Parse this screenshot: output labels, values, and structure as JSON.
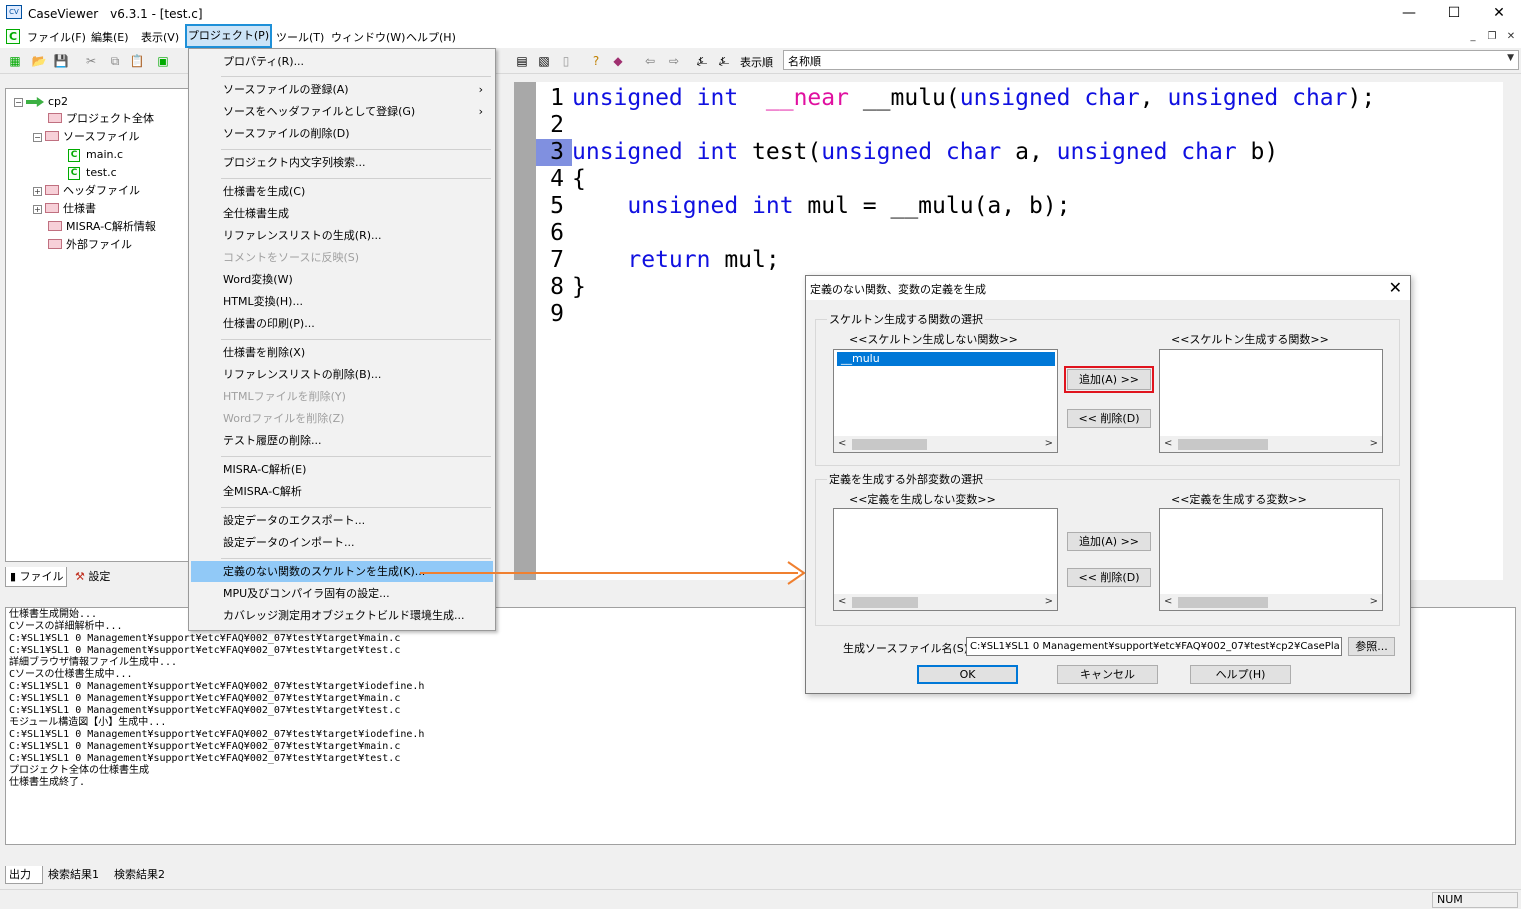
{
  "window": {
    "title": "CaseViewer　v6.3.1 - [test.c]",
    "app_icon": "caseviewer-icon",
    "minimize": "—",
    "maximize": "☐",
    "close": "✕"
  },
  "menubar": {
    "items": [
      "ファイル(F)",
      "編集(E)",
      "表示(V)",
      "プロジェクト(P)",
      "ツール(T)",
      "ウィンドウ(W)",
      "ヘルプ(H)"
    ],
    "mdi_min": "_",
    "mdi_restore": "❐",
    "mdi_close": "✕"
  },
  "toolbar": {
    "sort_label": "表示順",
    "sort_value": "名称順"
  },
  "tree": {
    "root": "cp2",
    "items": [
      "プロジェクト全体",
      "ソースファイル",
      "main.c",
      "test.c",
      "ヘッダファイル",
      "仕様書",
      "MISRA-C解析情報",
      "外部ファイル"
    ],
    "tabs": [
      "ファイル",
      "設定"
    ]
  },
  "editor": {
    "line_numbers": [
      "1",
      "2",
      "3",
      "4",
      "5",
      "6",
      "7",
      "8",
      "9"
    ],
    "active_line": 3,
    "lines": [
      [
        {
          "t": "unsigned int  ",
          "c": "kw"
        },
        {
          "t": "__near",
          "c": "mg"
        },
        {
          "t": " __mulu(",
          "c": ""
        },
        {
          "t": "unsigned char",
          "c": "kw"
        },
        {
          "t": ", ",
          "c": ""
        },
        {
          "t": "unsigned char",
          "c": "kw"
        },
        {
          "t": ");",
          "c": ""
        }
      ],
      [],
      [
        {
          "t": "unsigned int",
          "c": "kw"
        },
        {
          "t": " test(",
          "c": ""
        },
        {
          "t": "unsigned char",
          "c": "kw"
        },
        {
          "t": " a, ",
          "c": ""
        },
        {
          "t": "unsigned char",
          "c": "kw"
        },
        {
          "t": " b)",
          "c": ""
        }
      ],
      [
        {
          "t": "{",
          "c": ""
        }
      ],
      [
        {
          "t": "    ",
          "c": ""
        },
        {
          "t": "unsigned int",
          "c": "kw"
        },
        {
          "t": " mul = __mulu(a, b);",
          "c": ""
        }
      ],
      [],
      [
        {
          "t": "    ",
          "c": ""
        },
        {
          "t": "return",
          "c": "kw"
        },
        {
          "t": " mul;",
          "c": ""
        }
      ],
      [
        {
          "t": "}",
          "c": ""
        }
      ],
      []
    ]
  },
  "project_menu": {
    "items": [
      {
        "label": "プロパティ(R)...",
        "disabled": false
      },
      {
        "label": "ソースファイルの登録(A)",
        "disabled": false,
        "submenu": true
      },
      {
        "label": "ソースをヘッダファイルとして登録(G)",
        "disabled": false,
        "submenu": true
      },
      {
        "label": "ソースファイルの削除(D)",
        "disabled": false
      },
      {
        "label": "プロジェクト内文字列検索...",
        "disabled": false
      },
      {
        "label": "仕様書を生成(C)",
        "disabled": false
      },
      {
        "label": "全仕様書生成",
        "disabled": false
      },
      {
        "label": "リファレンスリストの生成(R)...",
        "disabled": false
      },
      {
        "label": "コメントをソースに反映(S)",
        "disabled": true
      },
      {
        "label": "Word変換(W)",
        "disabled": false
      },
      {
        "label": "HTML変換(H)...",
        "disabled": false
      },
      {
        "label": "仕様書の印刷(P)...",
        "disabled": false
      },
      {
        "label": "仕様書を削除(X)",
        "disabled": false
      },
      {
        "label": "リファレンスリストの削除(B)...",
        "disabled": false
      },
      {
        "label": "HTMLファイルを削除(Y)",
        "disabled": true
      },
      {
        "label": "Wordファイルを削除(Z)",
        "disabled": true
      },
      {
        "label": "テスト履歴の削除...",
        "disabled": false
      },
      {
        "label": "MISRA-C解析(E)",
        "disabled": false
      },
      {
        "label": "全MISRA-C解析",
        "disabled": false
      },
      {
        "label": "設定データのエクスポート...",
        "disabled": false
      },
      {
        "label": "設定データのインポート...",
        "disabled": false
      },
      {
        "label": "定義のない関数のスケルトンを生成(K)...",
        "disabled": false,
        "highlighted": true
      },
      {
        "label": "MPU及びコンパイラ固有の設定...",
        "disabled": false
      },
      {
        "label": "カバレッジ測定用オブジェクトビルド環境生成...",
        "disabled": false
      }
    ]
  },
  "output": {
    "lines": [
      "仕様書生成開始...",
      "Cソースの詳細解析中...",
      "C:¥SL1¥SL1 0 Management¥support¥etc¥FAQ¥002_07¥test¥target¥main.c",
      "C:¥SL1¥SL1 0 Management¥support¥etc¥FAQ¥002_07¥test¥target¥test.c",
      "詳細ブラウザ情報ファイル生成中...",
      "Cソースの仕様書生成中...",
      "C:¥SL1¥SL1 0 Management¥support¥etc¥FAQ¥002_07¥test¥target¥iodefine.h",
      "C:¥SL1¥SL1 0 Management¥support¥etc¥FAQ¥002_07¥test¥target¥main.c",
      "C:¥SL1¥SL1 0 Management¥support¥etc¥FAQ¥002_07¥test¥target¥test.c",
      "モジュール構造図【小】生成中...",
      "C:¥SL1¥SL1 0 Management¥support¥etc¥FAQ¥002_07¥test¥target¥iodefine.h",
      "C:¥SL1¥SL1 0 Management¥support¥etc¥FAQ¥002_07¥test¥target¥main.c",
      "C:¥SL1¥SL1 0 Management¥support¥etc¥FAQ¥002_07¥test¥target¥test.c",
      "プロジェクト全体の仕様書生成",
      "仕様書生成終了."
    ],
    "tabs": [
      "出力",
      "検索結果1",
      "検索結果2"
    ]
  },
  "status": {
    "num": "NUM"
  },
  "dialog": {
    "title": "定義のない関数、変数の定義を生成",
    "close": "✕",
    "func_group": "スケルトン生成する関数の選択",
    "func_left_label": "<<スケルトン生成しない関数>>",
    "func_right_label": "<<スケルトン生成する関数>>",
    "func_left_items": [
      "__mulu"
    ],
    "var_group": "定義を生成する外部変数の選択",
    "var_left_label": "<<定義を生成しない変数>>",
    "var_right_label": "<<定義を生成する変数>>",
    "add_label": "追加(A)  >>",
    "remove_label": "<<  削除(D)",
    "srcfile_label": "生成ソースファイル名(S):",
    "srcfile_value": "C:¥SL1¥SL1 0 Management¥support¥etc¥FAQ¥002_07¥test¥cp2¥CasePla",
    "browse": "参照...",
    "ok": "OK",
    "cancel": "キャンセル",
    "help": "ヘルプ(H)"
  },
  "colors": {
    "keyword": "#1010e0",
    "near_keyword": "#e010a0",
    "highlight_annotation": "#e0141e",
    "arrow": "#f08030",
    "menu_focus": "#1e90d8"
  }
}
